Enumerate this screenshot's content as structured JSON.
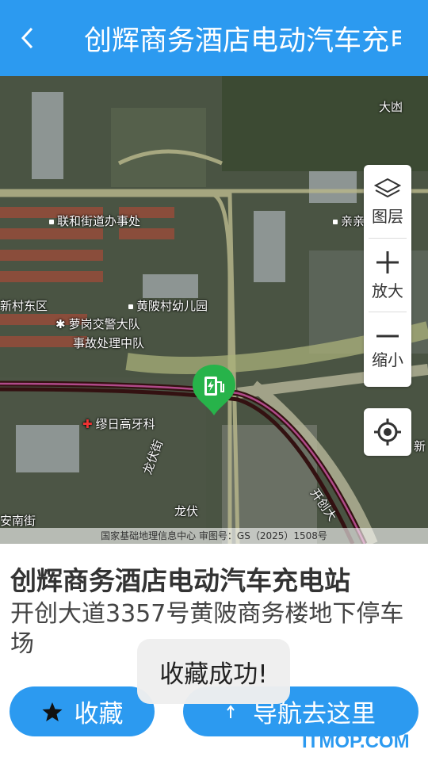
{
  "header": {
    "title": "创辉商务酒店电动汽车充电站"
  },
  "map": {
    "labels": {
      "dagang": "大凼",
      "qinqin": "亲亲",
      "lianhe": "联和街道办事处",
      "cundong": "新村东区",
      "huangpi": "黄陂村幼儿园",
      "luogang": "萝岗交警大队",
      "shigu": "事故处理中队",
      "mouri": "缪日高牙科",
      "longfujie": "龙伏街",
      "longfu": "龙伏",
      "kaichuang": "开创大",
      "annan": "安南街",
      "xin": "新"
    },
    "copyright": "国家基础地理信息中心  审图号：GS（2025）1508号"
  },
  "controls": {
    "layers": "图层",
    "zoom_in": "放大",
    "zoom_out": "缩小"
  },
  "station": {
    "name": "创辉商务酒店电动汽车充电站",
    "address": "开创大道3357号黄陂商务楼地下停车场"
  },
  "buttons": {
    "favorite": "收藏",
    "navigate": "导航去这里"
  },
  "toast": "收藏成功!",
  "watermark": "ITMOP.COM",
  "colors": {
    "primary": "#2c9af0",
    "marker": "#27b34a"
  }
}
